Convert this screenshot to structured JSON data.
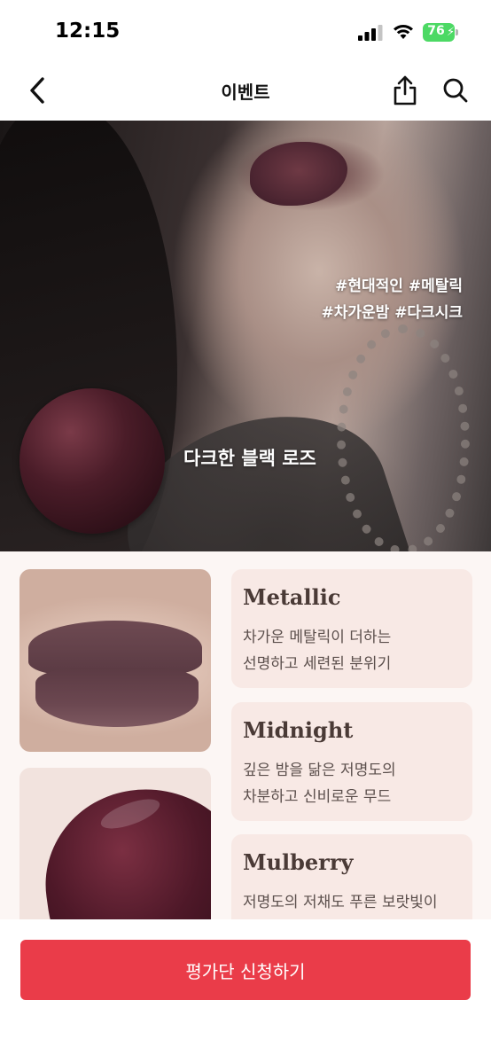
{
  "status_bar": {
    "time": "12:15",
    "battery": "76"
  },
  "header": {
    "title": "이벤트",
    "icons": [
      "chevron-left-icon",
      "share-icon",
      "search-icon"
    ]
  },
  "hero": {
    "hashtags_line1": "#현대적인 #메탈릭",
    "hashtags_line2": "#차가운밤 #다크시크",
    "shade_name": "다크한 블랙 로즈"
  },
  "features": [
    {
      "title": "Metallic",
      "line1": "차가운 메탈릭이 더하는",
      "line2": "선명하고 세련된 분위기"
    },
    {
      "title": "Midnight",
      "line1": "깊은 밤을 닮은 저명도의",
      "line2": "차분하고 신비로운 무드"
    },
    {
      "title": "Mulberry",
      "line1": "저명도의 저채도 푸른 보랏빛이",
      "line2": ""
    }
  ],
  "cta": {
    "label": "평가단 신청하기"
  },
  "colors": {
    "accent": "#ea3c49",
    "card_bg": "#f8e9e5",
    "section_bg": "#fcf6f4",
    "battery": "#4cd964"
  }
}
